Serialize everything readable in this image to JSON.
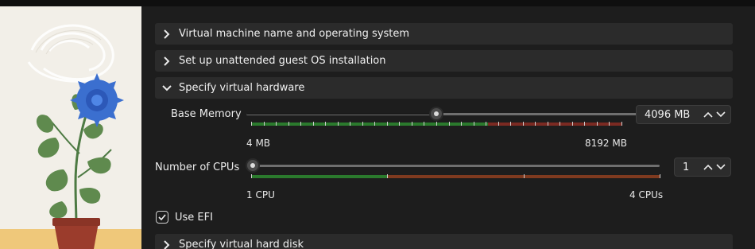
{
  "sections": {
    "s1": {
      "label": "Virtual machine name and operating system",
      "expanded": false
    },
    "s2": {
      "label": "Set up unattended guest OS installation",
      "expanded": false
    },
    "s3": {
      "label": "Specify virtual hardware",
      "expanded": true
    },
    "s4": {
      "label": "Specify virtual hard disk",
      "expanded": false
    }
  },
  "hardware": {
    "memory": {
      "label": "Base Memory",
      "value": "4096 MB",
      "min_label": "4 MB",
      "max_label": "8192 MB",
      "fraction": 0.5
    },
    "cpus": {
      "label": "Number of CPUs",
      "value": "1",
      "min_label": "1 CPU",
      "max_label": "4 CPUs",
      "fraction": 0.0
    },
    "efi": {
      "label": "Use EFI",
      "checked": true
    }
  },
  "icons": {
    "chevron_right": "chevron-right-icon",
    "chevron_down": "chevron-down-icon",
    "spin_up": "chevron-up-icon",
    "spin_down": "chevron-down-icon",
    "check": "checkmark-icon"
  },
  "colors": {
    "green": "#2b7a2d",
    "red": "#7b2a22",
    "orange_red": "#7f3a1f"
  }
}
